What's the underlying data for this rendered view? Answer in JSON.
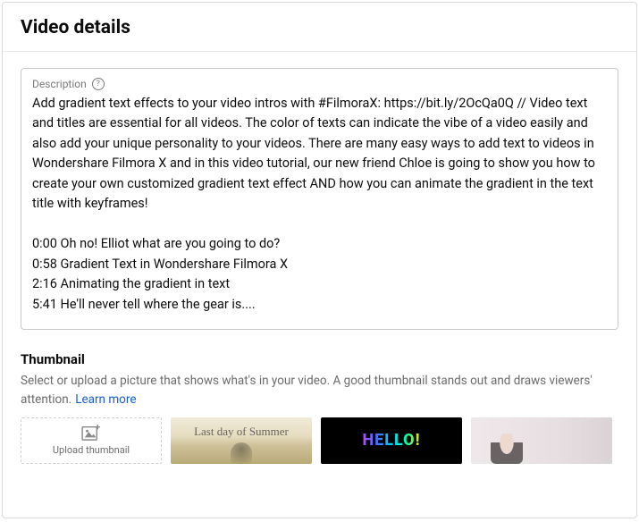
{
  "header": {
    "title": "Video details"
  },
  "description": {
    "label": "Description",
    "text": "Add gradient text effects to your video intros with #FilmoraX: https://bit.ly/2OcQa0Q // Video text and titles are essential for all videos. The color of texts can indicate the vibe of a video easily and also add your unique personality to your videos. There are many easy ways to add text to videos in Wondershare Filmora X and in this video tutorial, our new friend Chloe is going to show you how to create your own customized gradient text effect AND how you can animate the gradient in the text title with keyframes!\n\n0:00 Oh no! Elliot what are you going to do?\n0:58 Gradient Text in Wondershare Filmora X\n2:16 Animating the gradient in text\n5:41 He'll never tell where the gear is...."
  },
  "thumbnail": {
    "heading": "Thumbnail",
    "help": "Select or upload a picture that shows what's in your video. A good thumbnail stands out and draws viewers' attention.",
    "learn_more": "Learn more",
    "upload_label": "Upload thumbnail",
    "option_2_text": "Last day of Summer",
    "option_3_text": "HELLO!"
  }
}
